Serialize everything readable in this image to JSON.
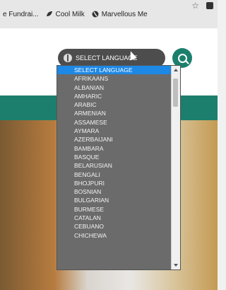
{
  "bookmarks": [
    {
      "label": "e Fundrai...",
      "icon": "page-icon"
    },
    {
      "label": "Cool Milk",
      "icon": "leaf-icon"
    },
    {
      "label": "Marvellous Me",
      "icon": "globe-icon"
    }
  ],
  "colors": {
    "accent": "#1c7f6d",
    "dropdown_bg": "#6b6b6b",
    "selected_bg": "#1e88e5"
  },
  "language_select": {
    "label": "SELECT LANGUAGE",
    "icon": "globe-icon"
  },
  "search_button": {
    "icon": "search-icon"
  },
  "dropdown": {
    "options": [
      "SELECT LANGUAGE",
      "AFRIKAANS",
      "ALBANIAN",
      "AMHARIC",
      "ARABIC",
      "ARMENIAN",
      "ASSAMESE",
      "AYMARA",
      "AZERBAIJANI",
      "BAMBARA",
      "BASQUE",
      "BELARUSIAN",
      "BENGALI",
      "BHOJPURI",
      "BOSNIAN",
      "BULGARIAN",
      "BURMESE",
      "CATALAN",
      "CEBUANO",
      "CHICHEWA"
    ],
    "selected_index": 0
  }
}
